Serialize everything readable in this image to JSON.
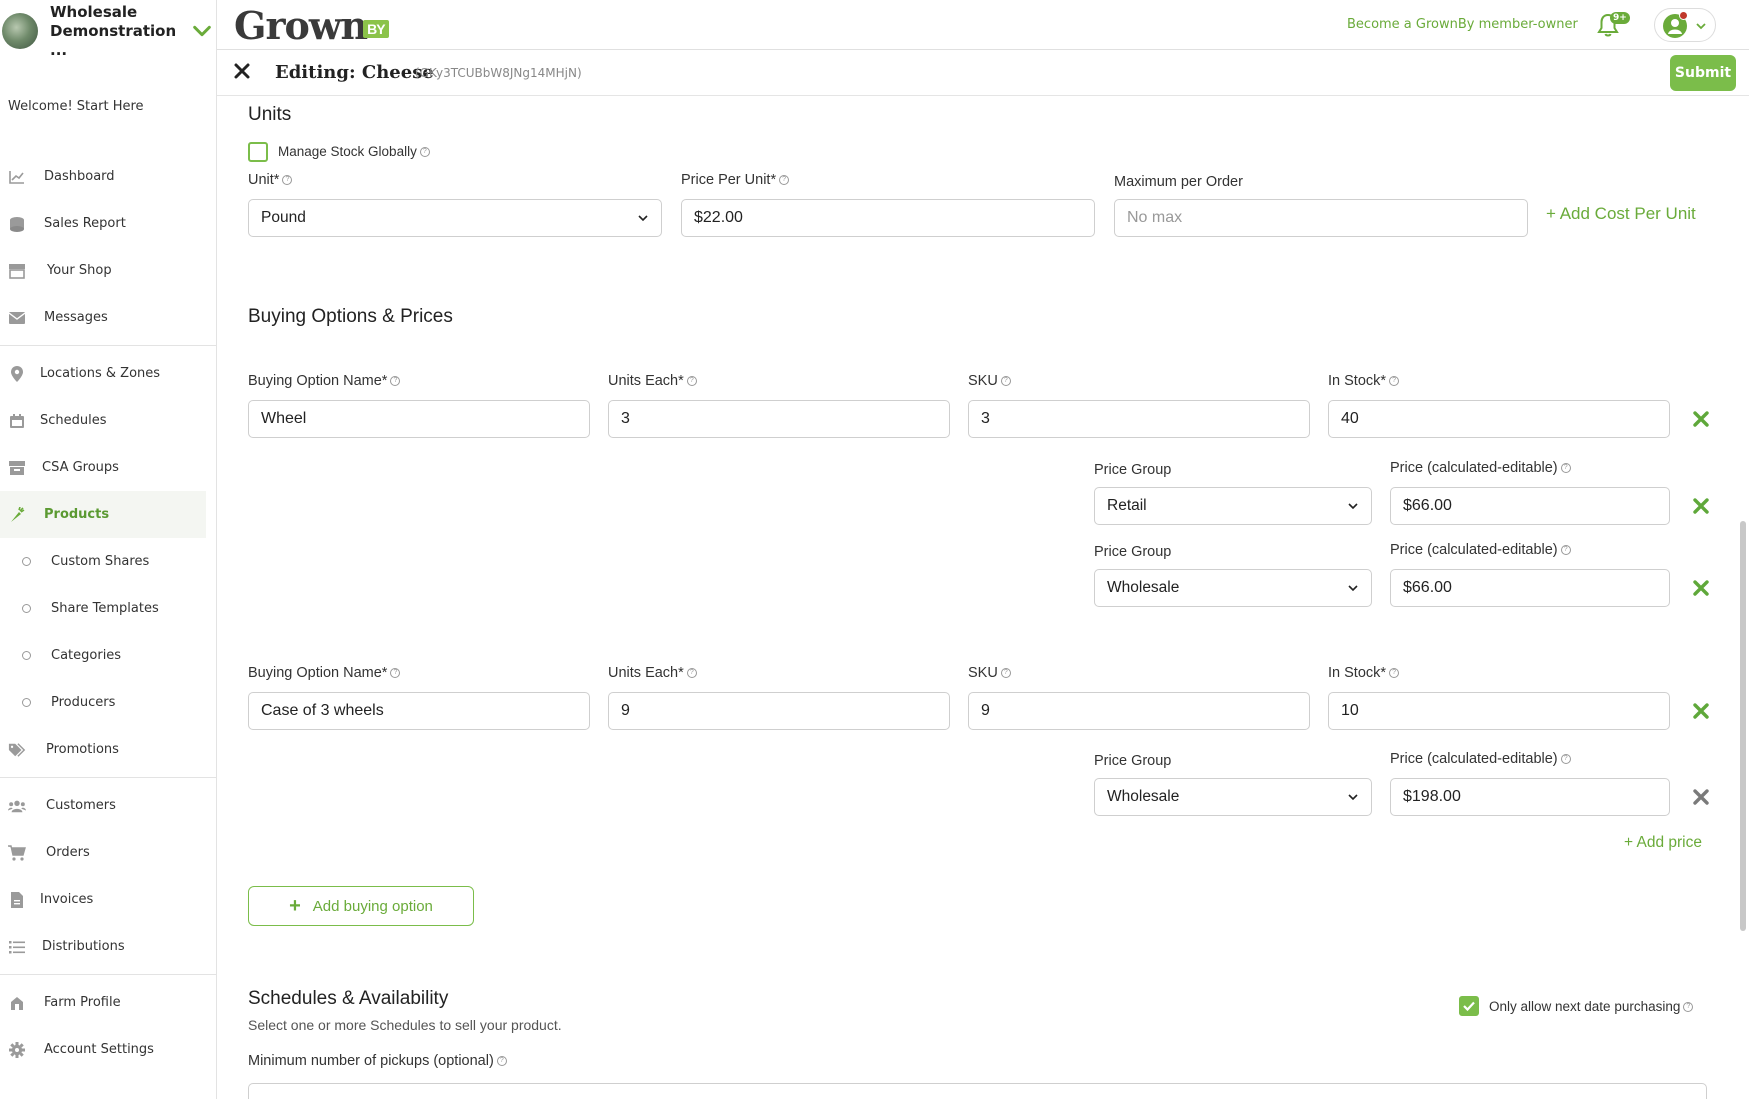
{
  "sidebar": {
    "farm_name": "Wholesale Demonstration ...",
    "welcome": "Welcome! Start Here",
    "items": [
      {
        "label": "Dashboard",
        "icon": "chart-icon"
      },
      {
        "label": "Sales Report",
        "icon": "coins-icon"
      },
      {
        "label": "Your Shop",
        "icon": "store-icon"
      },
      {
        "label": "Messages",
        "icon": "envelope-icon"
      },
      {
        "label": "Locations & Zones",
        "icon": "map-pin-icon"
      },
      {
        "label": "Schedules",
        "icon": "calendar-icon"
      },
      {
        "label": "CSA Groups",
        "icon": "box-icon"
      },
      {
        "label": "Products",
        "icon": "carrot-icon"
      },
      {
        "label": "Custom Shares"
      },
      {
        "label": "Share Templates"
      },
      {
        "label": "Categories"
      },
      {
        "label": "Producers"
      },
      {
        "label": "Promotions",
        "icon": "tags-icon"
      },
      {
        "label": "Customers",
        "icon": "users-icon"
      },
      {
        "label": "Orders",
        "icon": "cart-icon"
      },
      {
        "label": "Invoices",
        "icon": "invoice-icon"
      },
      {
        "label": "Distributions",
        "icon": "list-icon"
      },
      {
        "label": "Farm Profile",
        "icon": "farm-icon"
      },
      {
        "label": "Account Settings",
        "icon": "gear-icon"
      }
    ]
  },
  "topbar": {
    "logo": "Grown",
    "logo_badge": "BY",
    "member_link": "Become a GrownBy member-owner",
    "notifications_badge": "9+"
  },
  "edit_header": {
    "title": "Editing: Cheese",
    "product_id": "(GKy3TCUBbW8JNg14MHjN)",
    "submit": "Submit"
  },
  "units": {
    "heading": "Units",
    "manage_stock_label": "Manage Stock Globally",
    "manage_stock_checked": false,
    "unit_label": "Unit*",
    "unit_value": "Pound",
    "price_label": "Price Per Unit*",
    "price_value": "$22.00",
    "max_label": "Maximum per Order",
    "max_placeholder": "No max",
    "add_cost": "+ Add Cost Per Unit"
  },
  "buying": {
    "heading": "Buying Options & Prices",
    "name_label": "Buying Option Name*",
    "units_label": "Units Each*",
    "sku_label": "SKU",
    "stock_label": "In Stock*",
    "group_label": "Price Group",
    "price_label": "Price (calculated-editable)",
    "options": [
      {
        "name": "Wheel",
        "units": "3",
        "sku": "3",
        "stock": "40",
        "prices": [
          {
            "group": "Retail",
            "price": "$66.00"
          },
          {
            "group": "Wholesale",
            "price": "$66.00"
          }
        ]
      },
      {
        "name": "Case of 3 wheels",
        "units": "9",
        "sku": "9",
        "stock": "10",
        "prices": [
          {
            "group": "Wholesale",
            "price": "$198.00"
          }
        ]
      }
    ],
    "add_price": "+ Add price",
    "add_option": "Add buying option"
  },
  "schedules": {
    "heading": "Schedules & Availability",
    "subtext": "Select one or more Schedules to sell your product.",
    "next_date_label": "Only allow next date purchasing",
    "next_date_checked": true,
    "min_pickups_label": "Minimum number of pickups (optional)"
  },
  "colors": {
    "accent": "#7bbd4a",
    "link": "#6aab3a",
    "remove_active": "#5fa83a",
    "remove_disabled": "#7a7a7a"
  }
}
